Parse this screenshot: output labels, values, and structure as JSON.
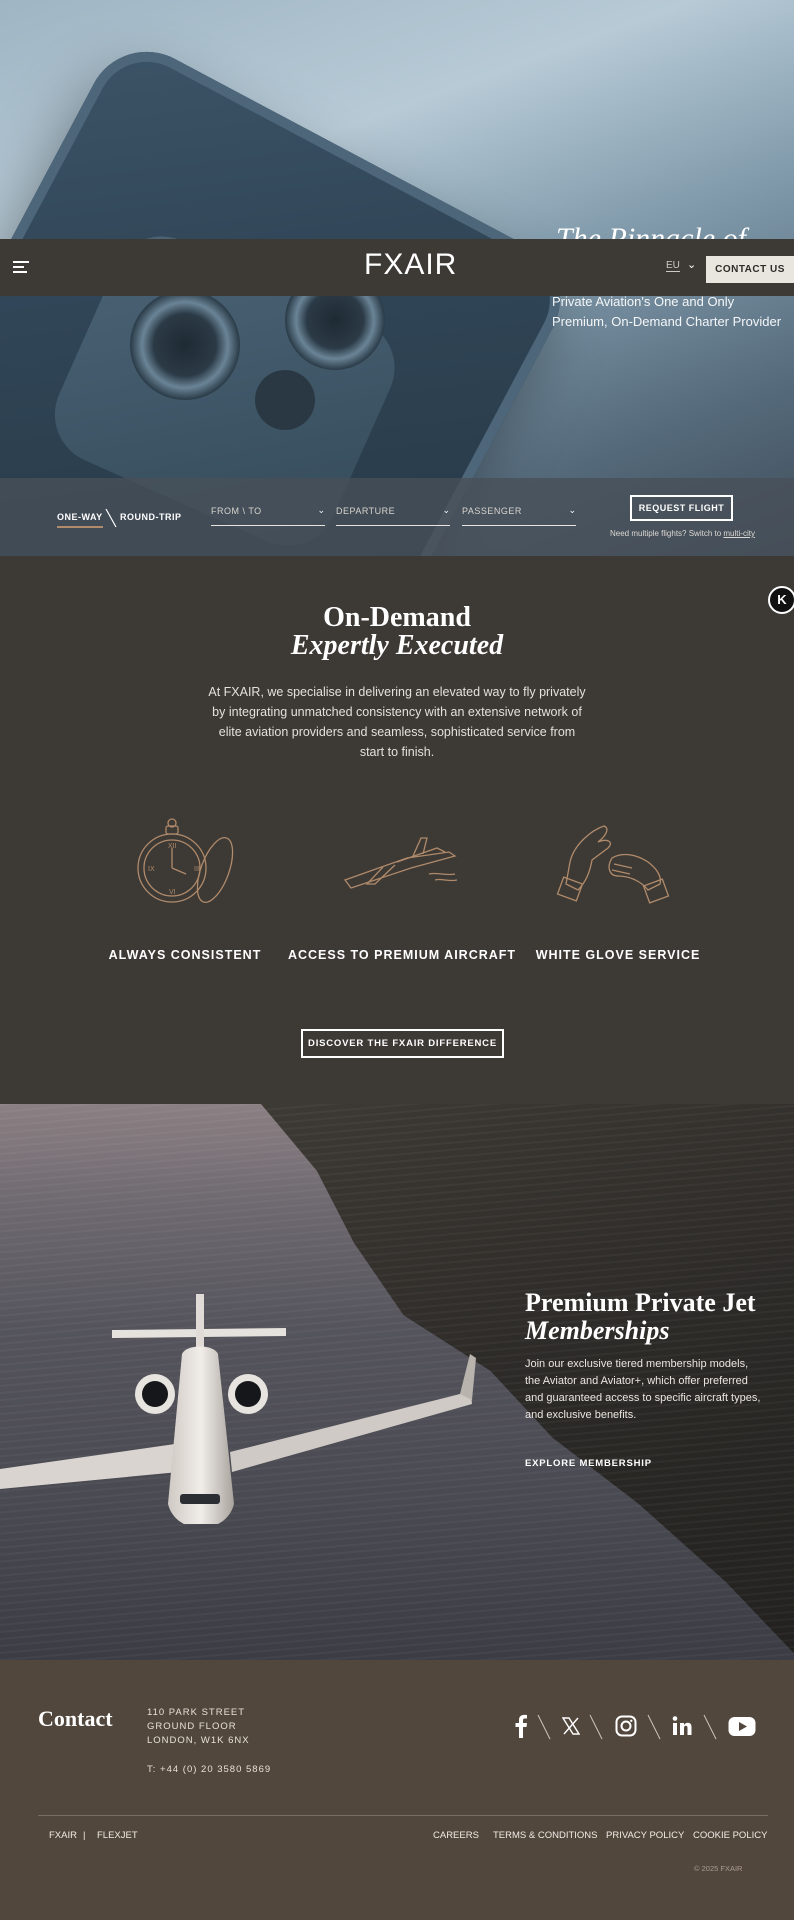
{
  "hero": {
    "title": "The Pinnacle of",
    "subtitle": "Private Aviation's One and Only Premium, On-Demand Charter Provider"
  },
  "header": {
    "logo": "FXAIR",
    "language": "EU",
    "contact_label": "CONTACT US"
  },
  "booking": {
    "one_way": "ONE-WAY",
    "round_trip": "ROUND-TRIP",
    "from_to": "FROM \\ TO",
    "departure": "DEPARTURE",
    "passenger": "PASSENGER",
    "request_label": "REQUEST FLIGHT",
    "multi_note": "Need multiple flights? Switch to ",
    "multi_link": "multi-city"
  },
  "intro": {
    "title": "On-Demand",
    "title_italic": "Expertly Executed",
    "text": "At FXAIR, we specialise in delivering an elevated way to fly privately by integrating unmatched consistency with an extensive network of elite aviation providers and seamless, sophisticated service from start to finish.",
    "badge": "K",
    "features": [
      {
        "label": "ALWAYS CONSISTENT",
        "icon": "pocket-watch-icon"
      },
      {
        "label": "ACCESS TO PREMIUM AIRCRAFT",
        "icon": "private-jet-icon"
      },
      {
        "label": "WHITE GLOVE SERVICE",
        "icon": "white-gloves-icon"
      }
    ],
    "discover_label": "DISCOVER THE FXAIR DIFFERENCE"
  },
  "membership": {
    "title": "Premium Private Jet",
    "title_italic": "Memberships",
    "text": "Join our exclusive tiered membership models, the Aviator and Aviator+, which offer preferred and guaranteed access to specific aircraft types, and exclusive benefits.",
    "explore_label": "EXPLORE MEMBERSHIP"
  },
  "footer": {
    "contact_title": "Contact",
    "address": [
      "110 PARK STREET",
      "GROUND FLOOR",
      "LONDON, W1K 6NX"
    ],
    "phone": "T: +44 (0) 20 3580 5869",
    "social": [
      "facebook-icon",
      "x-icon",
      "instagram-icon",
      "linkedin-icon",
      "youtube-icon"
    ],
    "links_left": [
      "FXAIR",
      "|",
      "FLEXJET"
    ],
    "links_right": [
      "CAREERS",
      "TERMS & CONDITIONS",
      "PRIVACY POLICY",
      "COOKIE POLICY"
    ],
    "copyright": "© 2025 FXAIR"
  },
  "colors": {
    "dark_panel": "#3d3a36",
    "footer": "#52473d",
    "accent_copper": "#b08a6a",
    "button_light": "#e9e6e0"
  }
}
